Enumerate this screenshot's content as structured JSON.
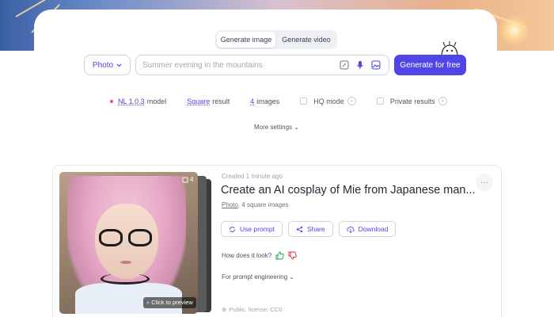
{
  "modes": [
    "Generate image",
    "Generate video"
  ],
  "search": {
    "type_label": "Photo",
    "placeholder": "Summer evening in the mountains",
    "generate_label": "Generate for free"
  },
  "options": {
    "model_value": "NL 1.0.3",
    "model_suffix": "model",
    "aspect_value": "Square",
    "aspect_suffix": "result",
    "count_value": "4",
    "count_suffix": "images",
    "hq_label": "HQ mode",
    "private_label": "Private results",
    "more_settings": "More settings"
  },
  "result": {
    "count": "4",
    "preview_label": "Click to preview",
    "created": "Created 1 minute ago",
    "title": "Create an AI cosplay of Mie from Japanese man...",
    "sub_type": "Photo",
    "sub_rest": ", 4 square images",
    "actions": [
      "Use prompt",
      "Share",
      "Download"
    ],
    "feedback_label": "How does it look?",
    "engineering_label": "For prompt engineering",
    "license": "Public, license: CC0"
  },
  "colors": {
    "accent": "#4f46e5",
    "dot": "#ec4899"
  }
}
